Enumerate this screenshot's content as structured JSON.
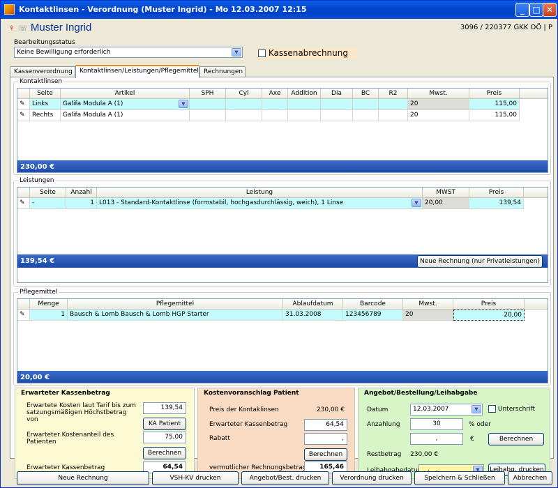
{
  "window": {
    "title": "Kontaktlinsen - Verordnung  (Muster Ingrid) - Mo 12.03.2007 12:15"
  },
  "patient": {
    "name": "Muster Ingrid",
    "id": "3096 / 220377 GKK OÖ | P"
  },
  "status": {
    "label": "Bearbeitungsstatus",
    "value": "Keine Bewilligung erforderlich",
    "kasse_label": "Kassenabrechnung"
  },
  "tabs": [
    "Kassenverordnung",
    "Kontaktlinsen/Leistungen/Pflegemittel",
    "Rechnungen"
  ],
  "kl": {
    "title": "Kontaktlinsen",
    "headers": [
      "Seite",
      "Artikel",
      "SPH",
      "Cyl",
      "Axe",
      "Addition",
      "Dia",
      "BC",
      "R2",
      "Mwst.",
      "Preis"
    ],
    "rows": [
      {
        "seite": "Links",
        "artikel": "Galifa Modula A (1)",
        "mwst": "20",
        "preis": "115,00"
      },
      {
        "seite": "Rechts",
        "artikel": "Galifa Modula A (1)",
        "mwst": "20",
        "preis": "115,00"
      }
    ],
    "total": "230,00 €"
  },
  "ls": {
    "title": "Leistungen",
    "headers": [
      "Seite",
      "Anzahl",
      "Leistung",
      "MWST",
      "Preis"
    ],
    "rows": [
      {
        "seite": "-",
        "anzahl": "1",
        "leistung": "L013 - Standard-Kontaktlinse (formstabil, hochgasdurchlässig, weich), 1 Linse",
        "mwst": "20,00",
        "preis": "139,54"
      }
    ],
    "total": "139,54 €",
    "button": "Neue Rechnung (nur Privatleistungen)"
  },
  "pm": {
    "title": "Pflegemittel",
    "headers": [
      "Menge",
      "Pflegemittel",
      "Ablaufdatum",
      "Barcode",
      "Mwst.",
      "Preis"
    ],
    "rows": [
      {
        "menge": "1",
        "name": "Bausch & Lomb Bausch & Lomb HGP Starter",
        "ablauf": "31.03.2008",
        "barcode": "123456789",
        "mwst": "20",
        "preis": "20,00"
      }
    ],
    "total": "20,00 €"
  },
  "ek": {
    "title": "Erwarteter Kassenbetrag",
    "l1": "Erwartete Kosten laut Tarif bis zum satzungsmäßigen Höchstbetrag von",
    "v1": "139,54",
    "b1": "KA Patient",
    "l2": "Erwarteter Kostenanteil des Patienten",
    "v2": "75,00",
    "b2": "Berechnen",
    "l3": "Erwarteter Kassenbetrag",
    "v3": "64,54"
  },
  "kv": {
    "title": "Kostenvoranschlag Patient",
    "l1": "Preis der Kontaklinsen",
    "v1": "230,00 €",
    "l2": "Erwarteter Kassenbetrag",
    "v2": "64,54",
    "l3": "Rabatt",
    "v3": ",",
    "b1": "Berechnen",
    "l4": "vermutlicher Rechnungsbetrag",
    "v4": "165,46"
  },
  "an": {
    "title": "Angebot/Bestellung/Leihabgabe",
    "datum_l": "Datum",
    "datum": "12.03.2007",
    "unterschrift": "Unterschrift",
    "anz_l": "Anzahlung",
    "anz": "30",
    "pct": "% oder",
    "eur_v": ",",
    "eur": "€",
    "b1": "Berechnen",
    "rest_l": "Restbetrag",
    "rest": "230,00 €",
    "leih_l": "Leihabgabedatum",
    "leih": "__.__.____",
    "b2": "Leihabg. drucken"
  },
  "actions": [
    "Neue Rechnung",
    "VSH-KV drucken",
    "Angebot/Best. drucken",
    "Verordnung drucken",
    "Speichern & Schließen",
    "Abbrechen"
  ],
  "colors": {
    "accent": "#1b48a8",
    "selected_row": "#c4fbfd"
  }
}
